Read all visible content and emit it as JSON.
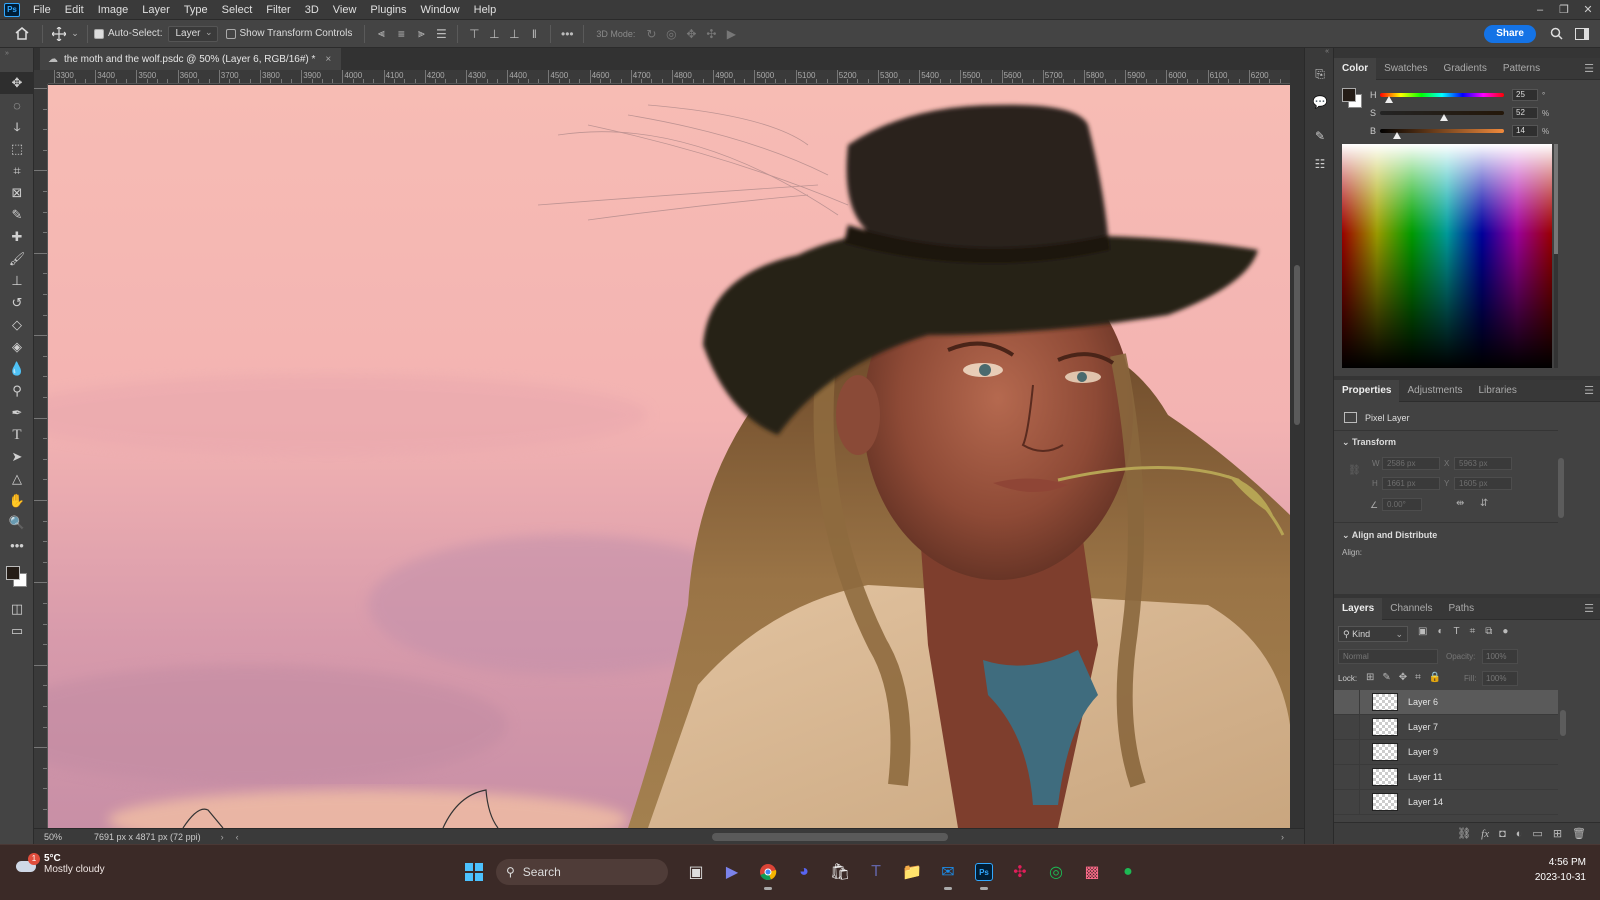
{
  "menu": {
    "logo": "Ps",
    "items": [
      "File",
      "Edit",
      "Image",
      "Layer",
      "Type",
      "Select",
      "Filter",
      "3D",
      "View",
      "Plugins",
      "Window",
      "Help"
    ],
    "controls": [
      "–",
      "❐",
      "✕"
    ]
  },
  "options": {
    "auto_select_label": "Auto-Select:",
    "auto_select_target": "Layer",
    "show_transform_label": "Show Transform Controls",
    "mode_3d_label": "3D Mode:",
    "share_label": "Share"
  },
  "document": {
    "tab_title": "the moth and the wolf.psdc @ 50% (Layer 6, RGB/16#) *",
    "zoom": "50%",
    "dimensions": "7691 px x 4871 px (72 ppi)"
  },
  "ruler": {
    "top_labels": [
      "3300",
      "3400",
      "3500",
      "3600",
      "3700",
      "3800",
      "3900",
      "4000",
      "4100",
      "4200",
      "4300",
      "4400",
      "4500",
      "4600",
      "4700",
      "4800",
      "4900",
      "5000",
      "5100",
      "5200",
      "5300",
      "5400",
      "5500",
      "5600",
      "5700",
      "5800",
      "5900",
      "6000",
      "6100",
      "6200"
    ]
  },
  "color_panel": {
    "tabs": [
      "Color",
      "Swatches",
      "Gradients",
      "Patterns"
    ],
    "h_label": "H",
    "h_value": "25",
    "h_unit": "°",
    "s_label": "S",
    "s_value": "52",
    "s_unit": "%",
    "b_label": "B",
    "b_value": "14",
    "b_unit": "%",
    "h_fraction": 0.07,
    "s_fraction": 0.52,
    "b_fraction": 0.14,
    "foreground": "#241c16",
    "background": "#ffffff"
  },
  "properties_panel": {
    "tabs": [
      "Properties",
      "Adjustments",
      "Libraries"
    ],
    "layer_type": "Pixel Layer",
    "transform_label": "Transform",
    "w_label": "W",
    "w_value": "2586 px",
    "x_label": "X",
    "x_value": "5963 px",
    "h_label": "H",
    "h_value": "1661 px",
    "y_label": "Y",
    "y_value": "1605 px",
    "angle_value": "0.00°",
    "align_label": "Align and Distribute",
    "align_sub": "Align:"
  },
  "layers_panel": {
    "tabs": [
      "Layers",
      "Channels",
      "Paths"
    ],
    "filter_label": "Kind",
    "blend_mode": "Normal",
    "opacity_label": "Opacity:",
    "opacity_value": "100%",
    "lock_label": "Lock:",
    "fill_label": "Fill:",
    "fill_value": "100%",
    "layers": [
      {
        "name": "Layer 6",
        "selected": true
      },
      {
        "name": "Layer 7",
        "selected": false
      },
      {
        "name": "Layer 9",
        "selected": false
      },
      {
        "name": "Layer 11",
        "selected": false
      },
      {
        "name": "Layer 14",
        "selected": false
      }
    ]
  },
  "taskbar": {
    "weather_temp": "5°C",
    "weather_desc": "Mostly cloudy",
    "weather_badge": "1",
    "search_label": "Search",
    "time": "4:56 PM",
    "date": "2023-10-31"
  },
  "colors": {
    "accent": "#1473e6",
    "sky_top": "#f6b8b2",
    "sky_bottom": "#c78ba4"
  }
}
